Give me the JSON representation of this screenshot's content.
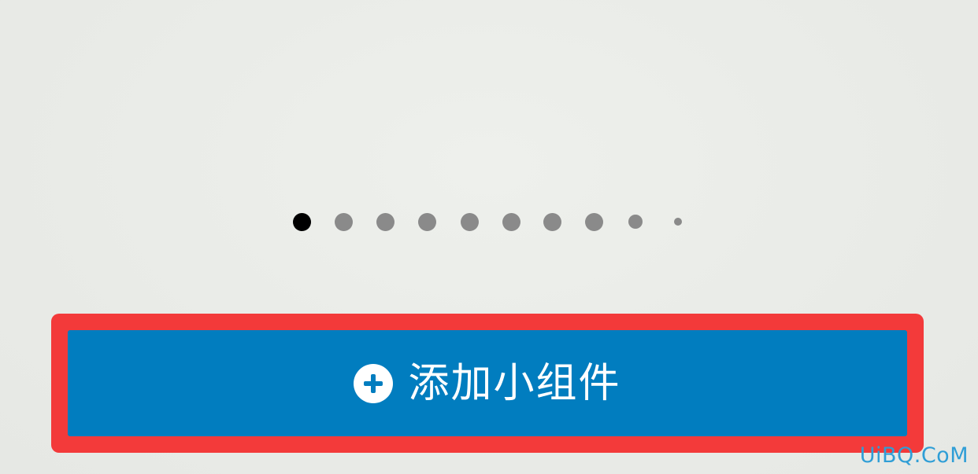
{
  "pager": {
    "total_pages": 10,
    "current_page": 1
  },
  "add_widget_button": {
    "label": "添加小组件",
    "icon": "plus-circle-icon"
  },
  "watermark": {
    "text": "UiBQ.CoM"
  },
  "colors": {
    "button": "#017dbf",
    "highlight": "#f33a3a",
    "dot_active": "#000000",
    "dot_inactive": "#8a8a8a",
    "watermark": "#2f9ed6"
  }
}
